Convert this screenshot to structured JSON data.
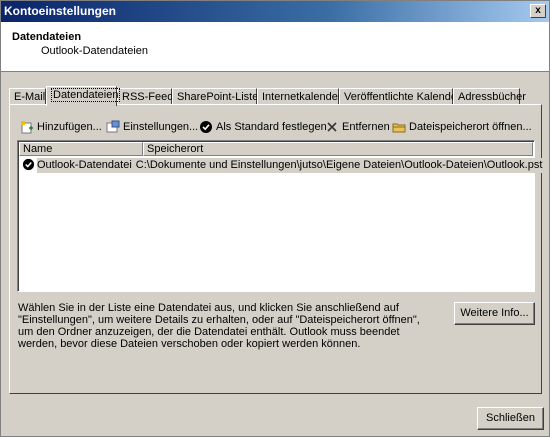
{
  "window": {
    "title": "Kontoeinstellungen",
    "close_glyph": "x"
  },
  "header": {
    "title": "Datendateien",
    "subtitle": "Outlook-Datendateien"
  },
  "tabs": [
    {
      "label": "E-Mail"
    },
    {
      "label": "Datendateien",
      "active": true
    },
    {
      "label": "RSS-Feeds"
    },
    {
      "label": "SharePoint-Listen"
    },
    {
      "label": "Internetkalender"
    },
    {
      "label": "Veröffentlichte Kalender"
    },
    {
      "label": "Adressbücher"
    }
  ],
  "toolbar": {
    "add": "Hinzufügen...",
    "settings": "Einstellungen...",
    "set_default": "Als Standard festlegen",
    "remove": "Entfernen",
    "open_location": "Dateispeicherort öffnen..."
  },
  "list": {
    "columns": [
      "Name",
      "Speicherort"
    ],
    "rows": [
      {
        "name": "Outlook-Datendatei",
        "location": "C:\\Dokumente und Einstellungen\\jutso\\Eigene Dateien\\Outlook-Dateien\\Outlook.pst",
        "default": true
      }
    ]
  },
  "description": "Wählen Sie in der Liste eine Datendatei aus, und klicken Sie anschließend auf \"Einstellungen\", um weitere Details zu erhalten, oder auf \"Dateispeicherort öffnen\", um den Ordner anzuzeigen, der die Datendatei enthält. Outlook muss beendet werden, bevor diese Dateien verschoben oder kopiert werden können.",
  "buttons": {
    "more_info": "Weitere Info...",
    "close": "Schließen"
  }
}
